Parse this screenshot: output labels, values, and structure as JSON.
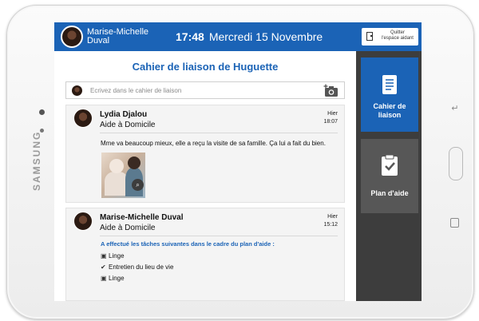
{
  "device": {
    "brand": "SAMSUNG"
  },
  "header": {
    "user_name": "Marise-Michelle",
    "user_surname": "Duval",
    "time": "17:48",
    "date": "Mercredi 15 Novembre",
    "quit_line1": "Quitter",
    "quit_line2": "l'espace aidant"
  },
  "main": {
    "title": "Cahier de liaison de Huguette",
    "composer_placeholder": "Ecrivez dans le cahier de liaison",
    "posts": [
      {
        "author": "Lydia Djalou",
        "role": "Aide à Domicile",
        "day": "Hier",
        "time": "18:07",
        "text": "Mme va beaucoup mieux, elle a reçu la visite de sa famille. Ça lui a fait du bien."
      },
      {
        "author": "Marise-Michelle Duval",
        "role": "Aide à Domicile",
        "day": "Hier",
        "time": "15:12",
        "tasks_heading": "A effectué les tâches suivantes dans le cadre du plan d'aide :",
        "tasks": [
          "Linge",
          "Entretien du lieu de vie",
          "Linge"
        ]
      }
    ]
  },
  "sidebar": {
    "items": [
      {
        "label_line1": "Cahier de",
        "label_line2": "liaison",
        "icon": "notebook-icon"
      },
      {
        "label_line1": "Plan d'aide",
        "icon": "clipboard-check-icon"
      }
    ]
  },
  "colors": {
    "primary": "#1b63b6",
    "sidebar_bg": "#3d3d3d",
    "sidebar_inactive": "#575757"
  }
}
